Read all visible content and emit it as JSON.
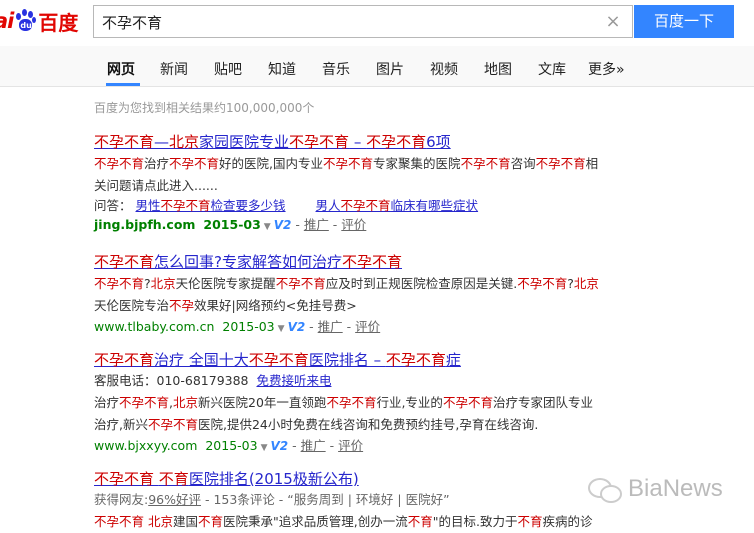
{
  "logo": {
    "part1": "ai",
    "paw_text": "du",
    "part2": "百度"
  },
  "search": {
    "query": "不孕不育",
    "button": "百度一下",
    "clear": "×"
  },
  "tabs": [
    "网页",
    "新闻",
    "贴吧",
    "知道",
    "音乐",
    "图片",
    "视频",
    "地图",
    "文库",
    "更多»"
  ],
  "result_count": "百度为您找到相关结果约100,000,000个",
  "results": [
    {
      "title": [
        "不孕不育",
        "—",
        "北京",
        "家园医院专业",
        "不孕不育",
        " – ",
        "不孕不育",
        "6项"
      ],
      "abstract_line1": [
        "不孕不育",
        "治疗",
        "不孕不育",
        "好的医院,国内专业",
        "不孕不育",
        "专家聚集的医院",
        "不孕不育",
        "咨询",
        "不孕不育",
        "相"
      ],
      "abstract_line2": "关问题请点此进入......",
      "sublinks_label": "问答：",
      "sublinks": [
        [
          "男性",
          "不孕不育",
          "检查要多少钱"
        ],
        [
          "男人",
          "不孕不育",
          "临床有哪些症状"
        ]
      ],
      "url": "jing.bjpfh.com",
      "date": "2015-03",
      "v": "V2",
      "promo": "推广",
      "eval": "评价"
    },
    {
      "title": [
        "不孕不育",
        "怎么回事?专家解答如何治疗",
        "不孕不育"
      ],
      "abstract_line1": [
        "不孕不育",
        "?",
        "北京",
        "天伦医院专家提醒",
        "不孕不育",
        "应及时到正规医院检查原因是关键.",
        "不孕不育",
        "?",
        "北京"
      ],
      "abstract_line2": [
        "天伦医院专治",
        "不孕",
        "效果好|网络预约<免挂号费>"
      ],
      "url": "www.tlbaby.com.cn",
      "date": "2015-03",
      "v": "V2",
      "promo": "推广",
      "eval": "评价"
    },
    {
      "title": [
        "不孕不育",
        "治疗  全国十大",
        "不孕不育",
        "医院排名 – ",
        "不孕不育",
        "症"
      ],
      "phone_label": "客服电话：",
      "phone": "010-68179388",
      "phone_link": "免费接听来电",
      "abstract_line1": [
        "治疗",
        "不孕不育",
        ",",
        "北京",
        "新兴医院20年一直领跑",
        "不孕不育",
        "行业,专业的",
        "不孕不育",
        "治疗专家团队专业"
      ],
      "abstract_line2": [
        "治疗,新兴",
        "不孕不育",
        "医院,提供24小时免费在线咨询和免费预约挂号,孕育在线咨询."
      ],
      "url": "www.bjxxyy.com",
      "date": "2015-03",
      "v": "V2",
      "promo": "推广",
      "eval": "评价"
    },
    {
      "title": [
        "不孕不育",
        " ",
        "不育",
        "医院排名(2015极新公布)"
      ],
      "meta_label": "获得网友:",
      "meta_rate": "96%好评",
      "meta_rest": " - 153条评论 - “服务周到 | 环境好 | 医院好”",
      "abstract_line1": [
        "不孕不育",
        " ",
        "北京",
        "建国",
        "不育",
        "医院秉承\"追求品质管理,创办一流",
        "不育",
        "\"的目标.致力于",
        "不育",
        "疾病的诊"
      ]
    }
  ],
  "watermark": "BiaNews"
}
